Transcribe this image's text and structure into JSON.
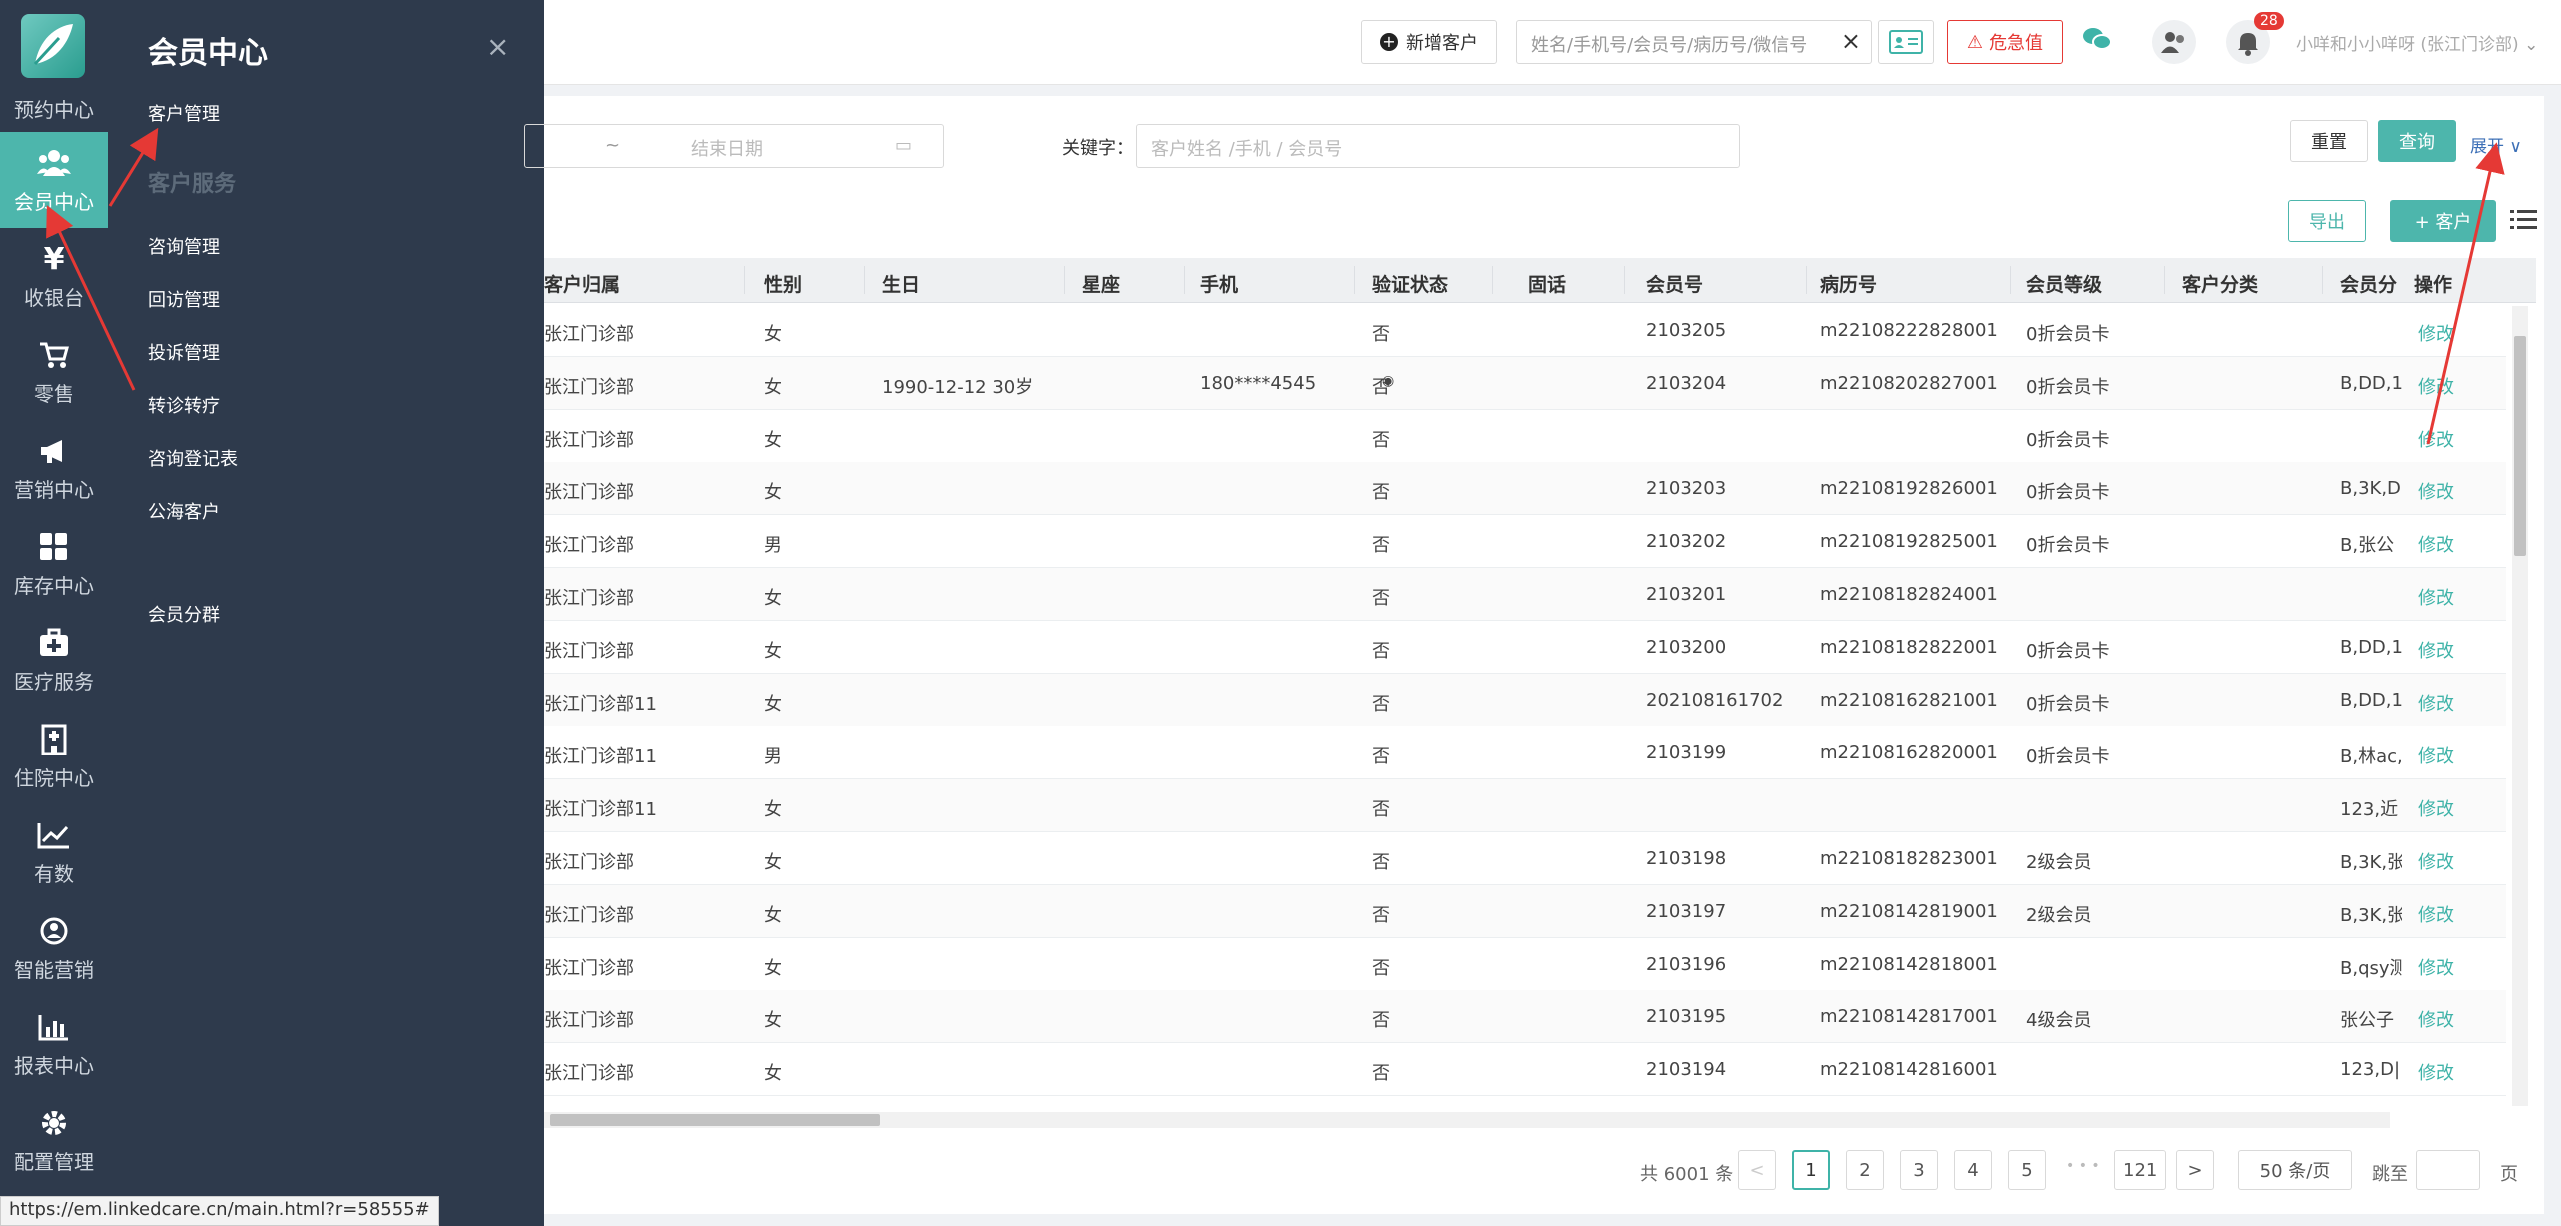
{
  "rail": {
    "items": [
      {
        "label": "预约中心",
        "icon": "calendar-icon"
      },
      {
        "label": "会员中心",
        "icon": "members-icon"
      },
      {
        "label": "收银台",
        "icon": "yen-icon"
      },
      {
        "label": "零售",
        "icon": "cart-icon"
      },
      {
        "label": "营销中心",
        "icon": "megaphone-icon"
      },
      {
        "label": "库存中心",
        "icon": "grid-icon"
      },
      {
        "label": "医疗服务",
        "icon": "medkit-icon"
      },
      {
        "label": "住院中心",
        "icon": "hospital-icon"
      },
      {
        "label": "有数",
        "icon": "trend-icon"
      },
      {
        "label": "智能营销",
        "icon": "brain-icon"
      },
      {
        "label": "报表中心",
        "icon": "bar-chart-icon"
      },
      {
        "label": "配置管理",
        "icon": "gear-icon"
      }
    ]
  },
  "flyout": {
    "title": "会员中心",
    "close": "×",
    "items": [
      "客户管理"
    ],
    "group": "客户服务",
    "group_items": [
      "咨询管理",
      "回访管理",
      "投诉管理",
      "转诊转疗",
      "咨询登记表",
      "公海客户"
    ],
    "extra": "会员分群"
  },
  "header": {
    "new_customer": "新增客户",
    "search_placeholder": "姓名/手机号/会员号/病历号/微信号",
    "search_clear": "×",
    "danger_button": "危急值",
    "notification_count": "28",
    "user": "小咩和小小咩呀 (张江门诊部)"
  },
  "filters": {
    "date_sep": "~",
    "end_date_placeholder": "结束日期",
    "keyword_label": "关键字：",
    "keyword_placeholder": "客户姓名 /手机 / 会员号",
    "reset": "重置",
    "query": "查询",
    "expand": "展开",
    "export": "导出",
    "add_customer": "+ 客户"
  },
  "table": {
    "columns": [
      "客户归属",
      "性别",
      "生日",
      "星座",
      "手机",
      "验证状态",
      "固话",
      "会员号",
      "病历号",
      "会员等级",
      "客户分类",
      "会员分",
      "操作"
    ],
    "rows": [
      {
        "dept": "张江门诊部",
        "sex": "女",
        "birthday": "",
        "phone": "",
        "verified": "否",
        "member_no": "2103205",
        "record_no": "m22108222828001",
        "level": "0折会员卡",
        "tags": "",
        "action": "修改"
      },
      {
        "dept": "张江门诊部",
        "sex": "女",
        "birthday": "1990-12-12   30岁",
        "phone": "180****4545",
        "verified": "否",
        "member_no": "2103204",
        "record_no": "m22108202827001",
        "level": "0折会员卡",
        "tags": "B,DD,1",
        "action": "修改"
      },
      {
        "dept": "张江门诊部",
        "sex": "女",
        "birthday": "",
        "phone": "",
        "verified": "否",
        "member_no": "",
        "record_no": "",
        "level": "0折会员卡",
        "tags": "",
        "action": "修改"
      },
      {
        "dept": "张江门诊部",
        "sex": "女",
        "birthday": "",
        "phone": "",
        "verified": "否",
        "member_no": "2103203",
        "record_no": "m22108192826001",
        "level": "0折会员卡",
        "tags": "B,3K,D",
        "action": "修改"
      },
      {
        "dept": "张江门诊部",
        "sex": "男",
        "birthday": "",
        "phone": "",
        "verified": "否",
        "member_no": "2103202",
        "record_no": "m22108192825001",
        "level": "0折会员卡",
        "tags": "B,张公",
        "action": "修改"
      },
      {
        "dept": "张江门诊部",
        "sex": "女",
        "birthday": "",
        "phone": "",
        "verified": "否",
        "member_no": "2103201",
        "record_no": "m22108182824001",
        "level": "",
        "tags": "",
        "action": "修改"
      },
      {
        "dept": "张江门诊部",
        "sex": "女",
        "birthday": "",
        "phone": "",
        "verified": "否",
        "member_no": "2103200",
        "record_no": "m22108182822001",
        "level": "0折会员卡",
        "tags": "B,DD,1",
        "action": "修改"
      },
      {
        "dept": "张江门诊部11",
        "sex": "女",
        "birthday": "",
        "phone": "",
        "verified": "否",
        "member_no": "202108161702",
        "record_no": "m22108162821001",
        "level": "0折会员卡",
        "tags": "B,DD,1",
        "action": "修改"
      },
      {
        "dept": "张江门诊部11",
        "sex": "男",
        "birthday": "",
        "phone": "",
        "verified": "否",
        "member_no": "2103199",
        "record_no": "m22108162820001",
        "level": "0折会员卡",
        "tags": "B,林ac,",
        "action": "修改"
      },
      {
        "dept": "张江门诊部11",
        "sex": "女",
        "birthday": "",
        "phone": "",
        "verified": "否",
        "member_no": "",
        "record_no": "",
        "level": "",
        "tags": "123,近",
        "action": "修改"
      },
      {
        "dept": "张江门诊部",
        "sex": "女",
        "birthday": "",
        "phone": "",
        "verified": "否",
        "member_no": "2103198",
        "record_no": "m22108182823001",
        "level": "2级会员",
        "tags": "B,3K,张",
        "action": "修改"
      },
      {
        "dept": "张江门诊部",
        "sex": "女",
        "birthday": "",
        "phone": "",
        "verified": "否",
        "member_no": "2103197",
        "record_no": "m22108142819001",
        "level": "2级会员",
        "tags": "B,3K,张",
        "action": "修改"
      },
      {
        "dept": "张江门诊部",
        "sex": "女",
        "birthday": "",
        "phone": "",
        "verified": "否",
        "member_no": "2103196",
        "record_no": "m22108142818001",
        "level": "",
        "tags": "B,qsy测",
        "action": "修改"
      },
      {
        "dept": "张江门诊部",
        "sex": "女",
        "birthday": "",
        "phone": "",
        "verified": "否",
        "member_no": "2103195",
        "record_no": "m22108142817001",
        "level": "4级会员",
        "tags": "张公子",
        "action": "修改"
      },
      {
        "dept": "张江门诊部",
        "sex": "女",
        "birthday": "",
        "phone": "",
        "verified": "否",
        "member_no": "2103194",
        "record_no": "m22108142816001",
        "level": "",
        "tags": "123,D|",
        "action": "修改"
      }
    ]
  },
  "pagination": {
    "total": "共 6001 条",
    "prev": "<",
    "pages": [
      "1",
      "2",
      "3",
      "4",
      "5"
    ],
    "ellipsis": "• • •",
    "last": "121",
    "next": ">",
    "page_size": "50 条/页",
    "goto_label": "跳至",
    "page_unit": "页"
  },
  "status_url": "https://em.linkedcare.cn/main.html?r=58555#",
  "colors": {
    "rail_bg": "#2e3a4c",
    "accent": "#4db6ac",
    "danger": "#e53935",
    "link": "#3fb3a8"
  }
}
